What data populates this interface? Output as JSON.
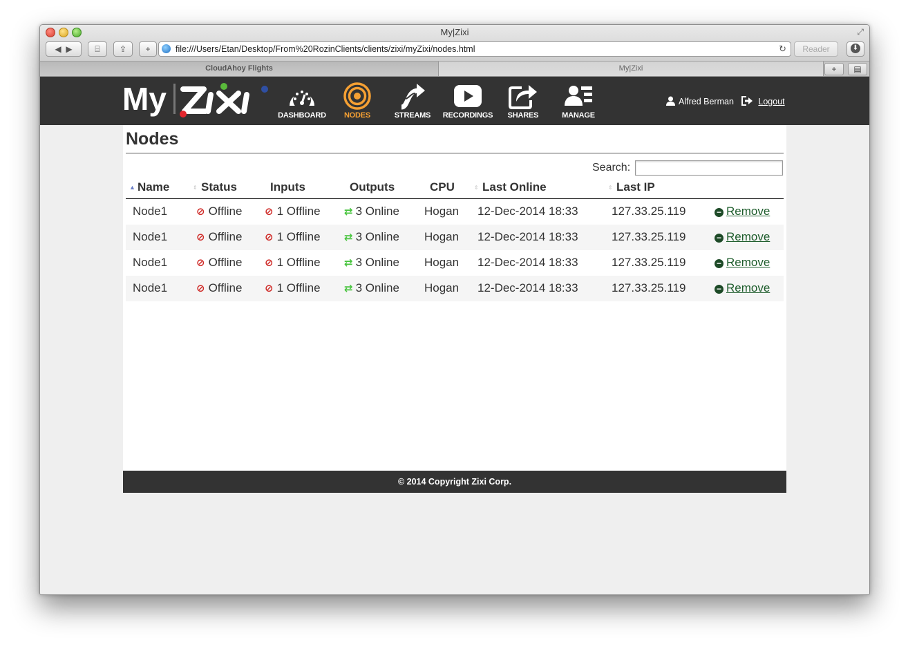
{
  "browser": {
    "title": "My|Zixi",
    "url": "file:///Users/Etan/Desktop/From%20RozinClients/clients/zixi/myZixi/nodes.html",
    "reader_label": "Reader",
    "tabs": [
      {
        "label": "CloudAhoy Flights"
      },
      {
        "label": "My|Zixi"
      }
    ]
  },
  "app": {
    "logo_text": "My|ZiXi",
    "nav": [
      {
        "label": "DASHBOARD",
        "icon": "gauge-icon"
      },
      {
        "label": "NODES",
        "icon": "target-icon",
        "active": true
      },
      {
        "label": "STREAMS",
        "icon": "streams-arrow-icon"
      },
      {
        "label": "RECORDINGS",
        "icon": "play-icon"
      },
      {
        "label": "SHARES",
        "icon": "share-icon"
      },
      {
        "label": "MANAGE",
        "icon": "users-icon"
      }
    ],
    "user_name": "Alfred Berman",
    "logout_label": "Logout",
    "active_color": "#f5a033",
    "header_bg": "#333333"
  },
  "page": {
    "title": "Nodes",
    "search_label": "Search:",
    "search_value": ""
  },
  "table": {
    "columns": [
      "Name",
      "Status",
      "Inputs",
      "Outputs",
      "CPU",
      "Last Online",
      "Last IP"
    ],
    "rows": [
      {
        "name": "Node1",
        "status": "Offline",
        "inputs": "1 Offline",
        "outputs": "3 Online",
        "cpu": "Hogan",
        "last_online": "12-Dec-2014 18:33",
        "last_ip": "127.33.25.119",
        "action": "Remove"
      },
      {
        "name": "Node1",
        "status": "Offline",
        "inputs": "1 Offline",
        "outputs": "3 Online",
        "cpu": "Hogan",
        "last_online": "12-Dec-2014 18:33",
        "last_ip": "127.33.25.119",
        "action": "Remove"
      },
      {
        "name": "Node1",
        "status": "Offline",
        "inputs": "1 Offline",
        "outputs": "3 Online",
        "cpu": "Hogan",
        "last_online": "12-Dec-2014 18:33",
        "last_ip": "127.33.25.119",
        "action": "Remove"
      },
      {
        "name": "Node1",
        "status": "Offline",
        "inputs": "1 Offline",
        "outputs": "3 Online",
        "cpu": "Hogan",
        "last_online": "12-Dec-2014 18:33",
        "last_ip": "127.33.25.119",
        "action": "Remove"
      }
    ]
  },
  "footer": {
    "copyright": "© 2014 Copyright Zixi Corp."
  }
}
